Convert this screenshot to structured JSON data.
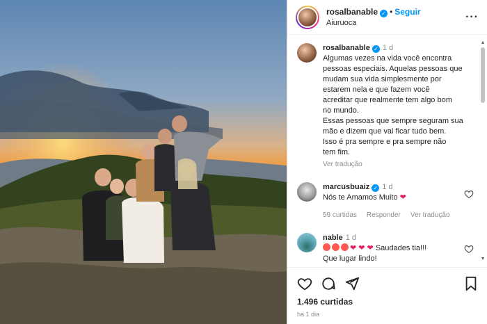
{
  "post": {
    "author": "rosalbanable",
    "follow_label": "Seguir",
    "location": "Aiuruoca",
    "likes": "1.496 curtidas",
    "posted_ago": "há 1 dia"
  },
  "caption": {
    "author": "rosalbanable",
    "time": "1 d",
    "lines": [
      "Algumas vezes na vida você encontra",
      "pessoas especiais. Aquelas pessoas que",
      "mudam sua vida simplesmente por",
      "estarem nela e que fazem você",
      "acreditar que realmente tem algo bom",
      "no mundo.",
      "Essas pessoas que sempre seguram sua",
      "mão e dizem que vai ficar tudo bem.",
      "Isso é pra sempre e pra sempre não",
      "tem fim."
    ],
    "translate_label": "Ver tradução"
  },
  "comments": [
    {
      "author": "marcusbuaiz",
      "time": "1 d",
      "text": "Nós te Amamos Muito",
      "likes": "59 curtidas",
      "reply_label": "Responder",
      "translate_label": "Ver tradução"
    },
    {
      "author": "nable",
      "time": "1 d",
      "text": "Saudades tia!!!",
      "text2": "Que lugar lindo!"
    }
  ],
  "colors": {
    "accent": "#0095f6",
    "heart": "#e0245e"
  },
  "icons": [
    "verified-badge-icon",
    "more-options-icon",
    "heart-icon",
    "comment-icon",
    "share-icon",
    "bookmark-icon"
  ]
}
